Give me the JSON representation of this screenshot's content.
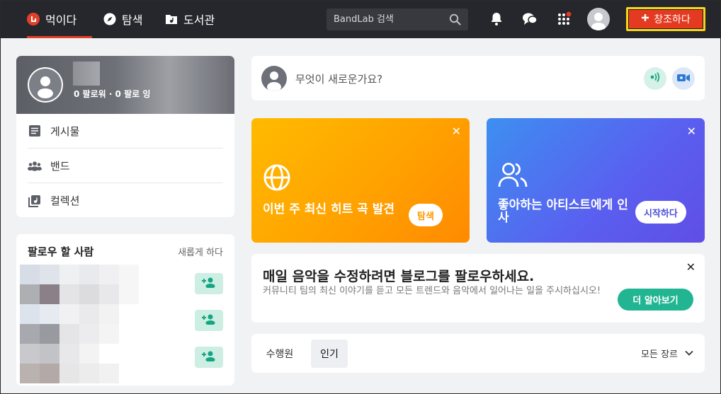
{
  "nav": {
    "feed_label": "먹이다",
    "explore_label": "탐색",
    "library_label": "도서관",
    "search_placeholder": "BandLab 검색",
    "create_label": "창조하다",
    "icons": [
      "bandlab-logo-icon",
      "compass-icon",
      "library-icon",
      "search-icon",
      "bell-icon",
      "chat-icon",
      "apps-grid-icon",
      "avatar-icon",
      "plus-icon"
    ]
  },
  "profile": {
    "stats": "0 팔로워 · 0 팔로 잉",
    "menu": [
      {
        "label": "게시물",
        "icon": "posts-icon"
      },
      {
        "label": "밴드",
        "icon": "band-icon"
      },
      {
        "label": "컬렉션",
        "icon": "collection-icon"
      }
    ]
  },
  "follow_suggestions": {
    "title": "팔로우 할 사람",
    "refresh_label": "새롭게 하다",
    "count": 3
  },
  "compose": {
    "placeholder": "무엇이 새로운가요?"
  },
  "promos": [
    {
      "text": "이번 주 최신 히트 곡 발견",
      "button": "탐색",
      "icon": "globe-icon",
      "color": "#ffa200"
    },
    {
      "text": "좋아하는 아티스트에게 인사",
      "button": "시작하다",
      "icon": "users-icon",
      "color": "#5a5ff0"
    }
  ],
  "blog": {
    "title": "매일 음악을 수정하려면 블로그를 팔로우하세요.",
    "subtitle": "커뮤니티 팀의 최신 이야기를 듣고 모든 트렌드와 음악에서 일어나는 일을 주시하십시오!",
    "button": "더 알아보기"
  },
  "feed_tabs": {
    "tabs": [
      "수행원",
      "인기"
    ],
    "active": "인기",
    "genre_label": "모든 장르"
  },
  "colors": {
    "accent": "#e43a22",
    "nav_bg": "#26272c",
    "green": "#22b592",
    "highlight": "#f5d617"
  }
}
